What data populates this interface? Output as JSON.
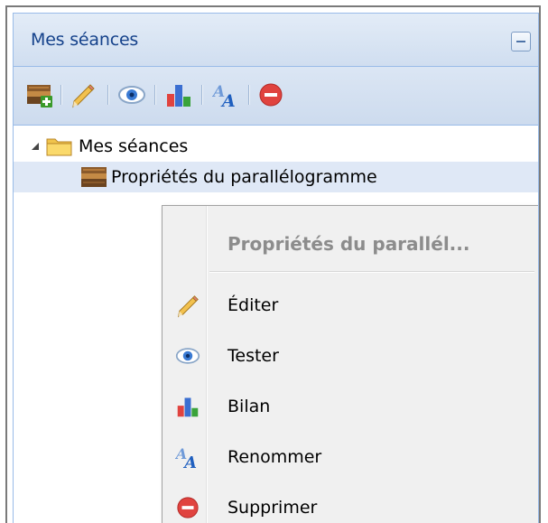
{
  "panel": {
    "title": "Mes séances"
  },
  "toolbar": {
    "buttons": [
      {
        "icon": "new-session-icon"
      },
      {
        "icon": "pencil-icon"
      },
      {
        "icon": "eye-icon"
      },
      {
        "icon": "bar-chart-icon"
      },
      {
        "icon": "rename-icon"
      },
      {
        "icon": "delete-icon"
      }
    ]
  },
  "tree": {
    "root": {
      "label": "Mes séances",
      "icon": "folder-icon",
      "expanded": true
    },
    "items": [
      {
        "label": "Propriétés du parallélogramme",
        "icon": "session-icon",
        "selected": true
      }
    ]
  },
  "context_menu": {
    "title": "Propriétés du parallél...",
    "items": [
      {
        "label": "Éditer",
        "icon": "pencil-icon"
      },
      {
        "label": "Tester",
        "icon": "eye-icon"
      },
      {
        "label": "Bilan",
        "icon": "bar-chart-icon"
      },
      {
        "label": "Renommer",
        "icon": "rename-icon"
      },
      {
        "label": "Supprimer",
        "icon": "delete-icon"
      }
    ]
  },
  "colors": {
    "header_text": "#15428b",
    "header_bg": "#d0def0",
    "selection_bg": "#dfe8f6",
    "menu_bg": "#f0f0f0",
    "menu_title": "#8c8c8c",
    "delete_red": "#e0433f"
  }
}
